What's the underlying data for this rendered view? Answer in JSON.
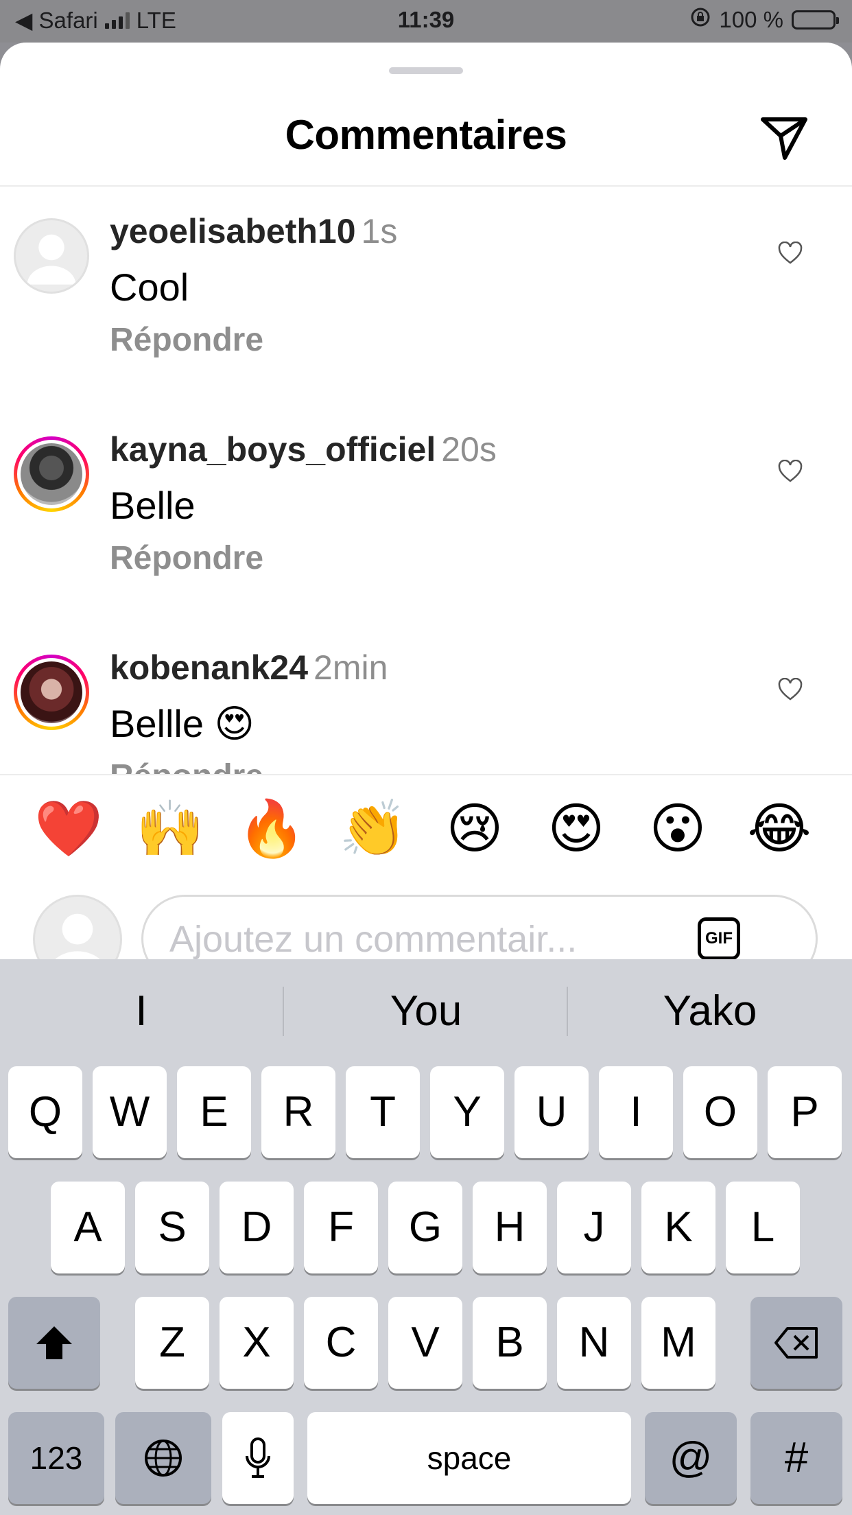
{
  "status_bar": {
    "back_app": "◀ Safari",
    "network": "LTE",
    "time": "11:39",
    "battery": "100 %"
  },
  "header": {
    "title": "Commentaires"
  },
  "comments": [
    {
      "user": "yeoelisabeth10",
      "time": "1s",
      "text": "Cool",
      "reply": "Répondre"
    },
    {
      "user": "kayna_boys_officiel",
      "time": "20s",
      "text": "Belle",
      "reply": "Répondre"
    },
    {
      "user": "kobenank24",
      "time": "2min",
      "text": "Bellle 😍",
      "reply": "Répondre"
    }
  ],
  "emoji_bar": [
    "❤️",
    "🙌",
    "🔥",
    "👏",
    "😢",
    "😍",
    "😮",
    "😂"
  ],
  "comment_input": {
    "placeholder": "Ajoutez un commentair...",
    "gif_label": "GIF"
  },
  "keyboard": {
    "suggestions": [
      "I",
      "You",
      "Yako"
    ],
    "row1": [
      "Q",
      "W",
      "E",
      "R",
      "T",
      "Y",
      "U",
      "I",
      "O",
      "P"
    ],
    "row2": [
      "A",
      "S",
      "D",
      "F",
      "G",
      "H",
      "J",
      "K",
      "L"
    ],
    "row3": [
      "Z",
      "X",
      "C",
      "V",
      "B",
      "N",
      "M"
    ],
    "numbers_key": "123",
    "space_key": "space",
    "at_key": "@",
    "hash_key": "#"
  }
}
